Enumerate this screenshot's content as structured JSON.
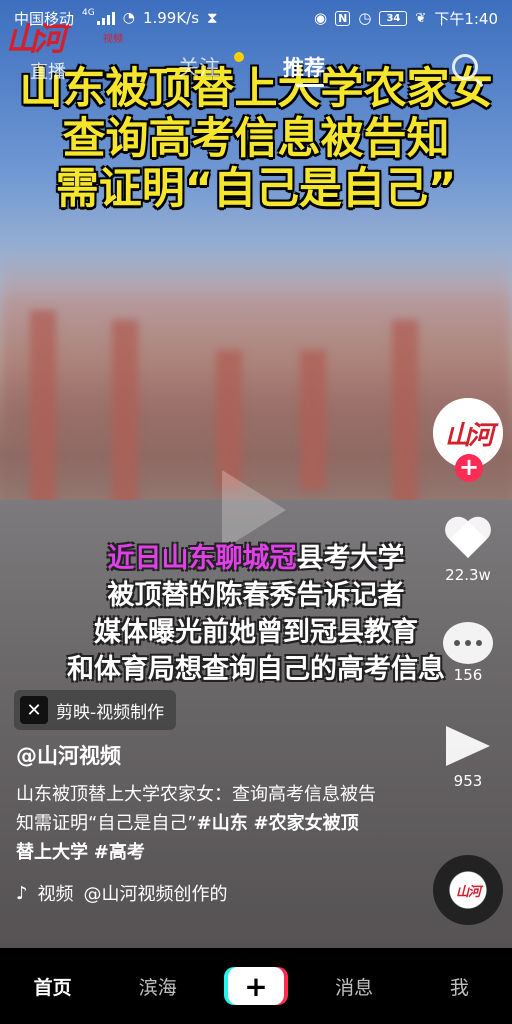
{
  "status_bar": {
    "carrier": "中国移动",
    "network": "4G",
    "speed": "1.99K/s",
    "battery": "34",
    "time": "下午1:40"
  },
  "brand_logo": {
    "text": "山河",
    "sub": "视频"
  },
  "top_nav": {
    "live": "直播",
    "follow": "关注",
    "recommend": "推荐",
    "active": "推荐"
  },
  "video": {
    "headline": [
      "山东被顶替上大学农家女",
      "查询高考信息被告知",
      "需证明“自己是自己”"
    ],
    "subtitles": {
      "line1_highlight": "近日山东聊城冠",
      "line1_rest": "县考大学",
      "line2": "被顶替的陈春秀告诉记者",
      "line3": "媒体曝光前她曾到冠县教育",
      "line4": "和体育局想查询自己的高考信息"
    }
  },
  "capcut_tag": {
    "icon": "capcut-icon",
    "label": "剪映-视频制作"
  },
  "post": {
    "author": "@山河视频",
    "description": "山东被顶替上大学农家女：查询高考信息被告知需证明“自己是自己”",
    "tags": [
      "#山东",
      "#农家女被顶替上大学",
      "#高考"
    ],
    "music_prefix": "视频",
    "music": "@山河视频创作的"
  },
  "sidebar": {
    "avatar_text": "山河",
    "likes": "22.3w",
    "comments": "156",
    "shares": "953"
  },
  "tab_bar": {
    "home": "首页",
    "city": "滨海",
    "create": "+",
    "messages": "消息",
    "me": "我"
  },
  "colors": {
    "headline": "#f5e62b",
    "highlight": "#e040e8",
    "brand_red": "#d4202c",
    "follow_plus": "#fe2c55"
  }
}
